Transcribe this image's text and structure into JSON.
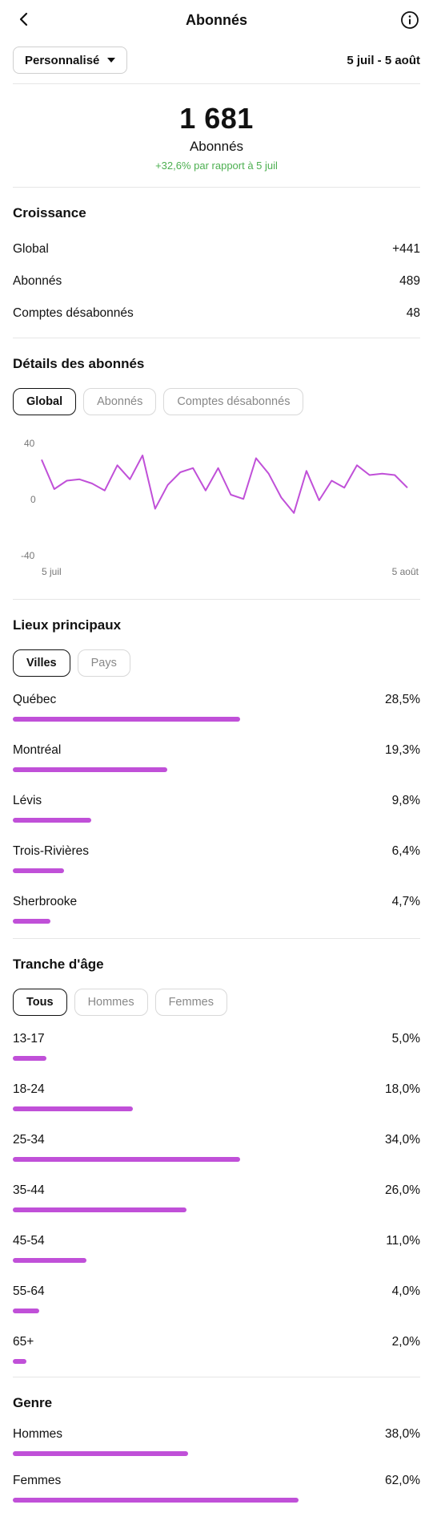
{
  "header": {
    "title": "Abonnés",
    "back_icon": "chevron-left-icon",
    "info_icon": "info-icon"
  },
  "filter": {
    "dropdown_label": "Personnalisé",
    "date_range": "5 juil - 5 août"
  },
  "summary": {
    "value": "1 681",
    "label": "Abonnés",
    "change": "+32,6% par rapport à 5 juil"
  },
  "growth": {
    "title": "Croissance",
    "rows": [
      {
        "label": "Global",
        "value": "+441"
      },
      {
        "label": "Abonnés",
        "value": "489"
      },
      {
        "label": "Comptes désabonnés",
        "value": "48"
      }
    ]
  },
  "details": {
    "title": "Détails des abonnés",
    "tabs": [
      "Global",
      "Abonnés",
      "Comptes désabonnés"
    ],
    "active_tab": 0
  },
  "chart_data": {
    "type": "line",
    "x_start_label": "5 juil",
    "x_end_label": "5 août",
    "y_ticks": [
      "40",
      "0",
      "-40"
    ],
    "ylim": [
      -40,
      40
    ],
    "line_color": "#c050d8",
    "values": [
      29,
      8,
      14,
      15,
      12,
      7,
      25,
      15,
      32,
      -6,
      11,
      20,
      23,
      7,
      23,
      4,
      1,
      30,
      19,
      2,
      -9,
      21,
      0,
      14,
      9,
      25,
      18,
      19,
      18,
      9
    ]
  },
  "locations": {
    "title": "Lieux principaux",
    "tabs": [
      "Villes",
      "Pays"
    ],
    "active_tab": 0,
    "items": [
      {
        "label": "Québec",
        "value": "28,5%",
        "pct": 28.5
      },
      {
        "label": "Montréal",
        "value": "19,3%",
        "pct": 19.3
      },
      {
        "label": "Lévis",
        "value": "9,8%",
        "pct": 9.8
      },
      {
        "label": "Trois-Rivières",
        "value": "6,4%",
        "pct": 6.4
      },
      {
        "label": "Sherbrooke",
        "value": "4,7%",
        "pct": 4.7
      }
    ]
  },
  "age": {
    "title": "Tranche d'âge",
    "tabs": [
      "Tous",
      "Hommes",
      "Femmes"
    ],
    "active_tab": 0,
    "items": [
      {
        "label": "13-17",
        "value": "5,0%",
        "pct": 5.0
      },
      {
        "label": "18-24",
        "value": "18,0%",
        "pct": 18.0
      },
      {
        "label": "25-34",
        "value": "34,0%",
        "pct": 34.0
      },
      {
        "label": "35-44",
        "value": "26,0%",
        "pct": 26.0
      },
      {
        "label": "45-54",
        "value": "11,0%",
        "pct": 11.0
      },
      {
        "label": "55-64",
        "value": "4,0%",
        "pct": 4.0
      },
      {
        "label": "65+",
        "value": "2,0%",
        "pct": 2.0
      }
    ]
  },
  "gender": {
    "title": "Genre",
    "items": [
      {
        "label": "Hommes",
        "value": "38,0%",
        "pct": 38.0
      },
      {
        "label": "Femmes",
        "value": "62,0%",
        "pct": 62.0
      }
    ]
  }
}
